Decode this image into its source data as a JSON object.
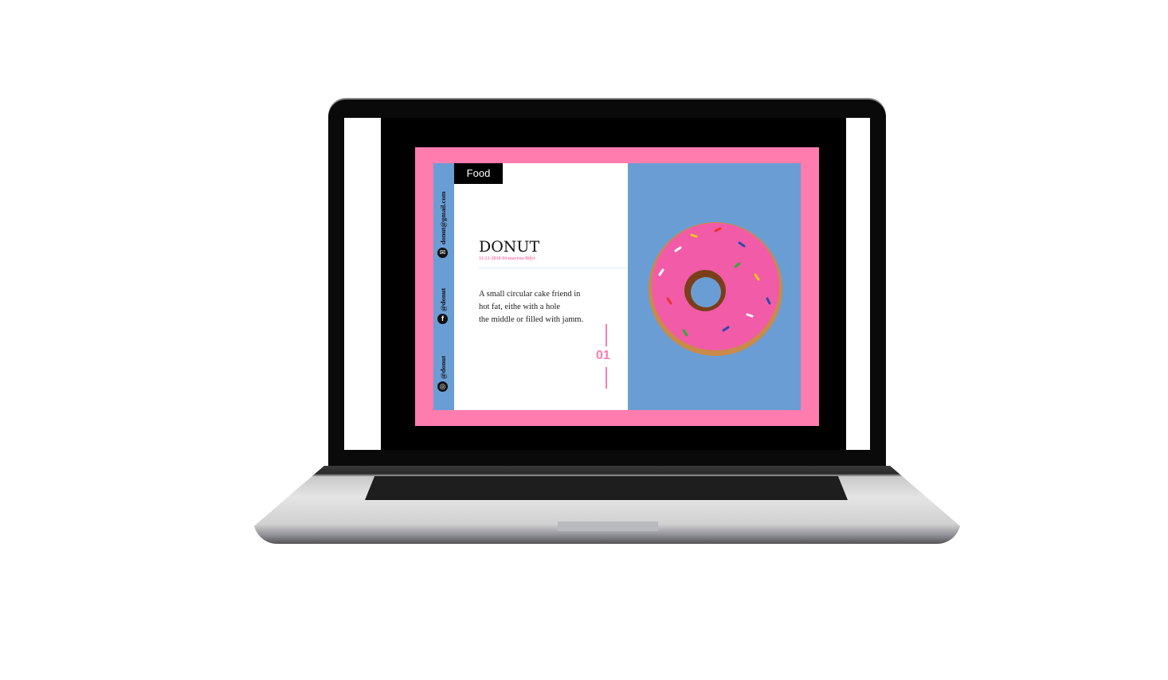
{
  "tag": "Food",
  "title": "DONUT",
  "meta": "11-21-2018 64 maryna Bilyi",
  "body_lines": [
    "A small circular cake friend in",
    "hot  fat, eithe with a hole",
    "the middle or filled with jamm."
  ],
  "page_number": "01",
  "social": {
    "email": "donut@gmail.com",
    "facebook": "@donut",
    "instagram": "@donut"
  },
  "colors": {
    "pink": "#fe7cae",
    "blue": "#6a9dd4"
  }
}
